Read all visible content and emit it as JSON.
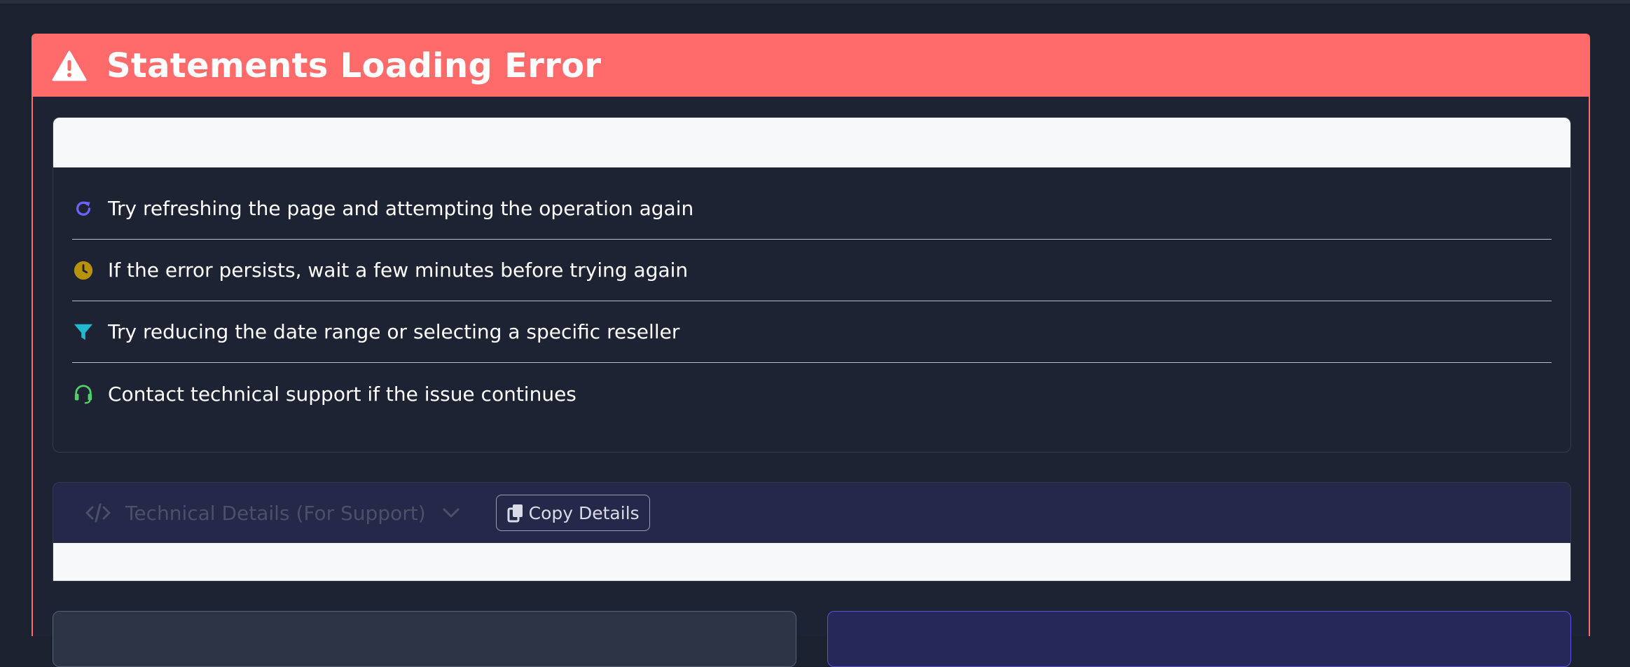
{
  "header": {
    "title": "Statements Loading Error",
    "icon": "warning-triangle-icon",
    "color": "#ff6b6b"
  },
  "steps": {
    "heading": "",
    "items": [
      {
        "icon": "refresh-icon",
        "color": "#6c63ff",
        "text": "Try refreshing the page and attempting the operation again"
      },
      {
        "icon": "clock-icon",
        "color": "#b8930a",
        "text": "If the error persists, wait a few minutes before trying again"
      },
      {
        "icon": "filter-icon",
        "color": "#22b8cf",
        "text": "Try reducing the date range or selecting a specific reseller"
      },
      {
        "icon": "headset-icon",
        "color": "#51cf66",
        "text": "Contact technical support if the issue continues"
      }
    ]
  },
  "technical": {
    "label": "Technical Details (For Support)",
    "copy_label": "Copy Details"
  }
}
